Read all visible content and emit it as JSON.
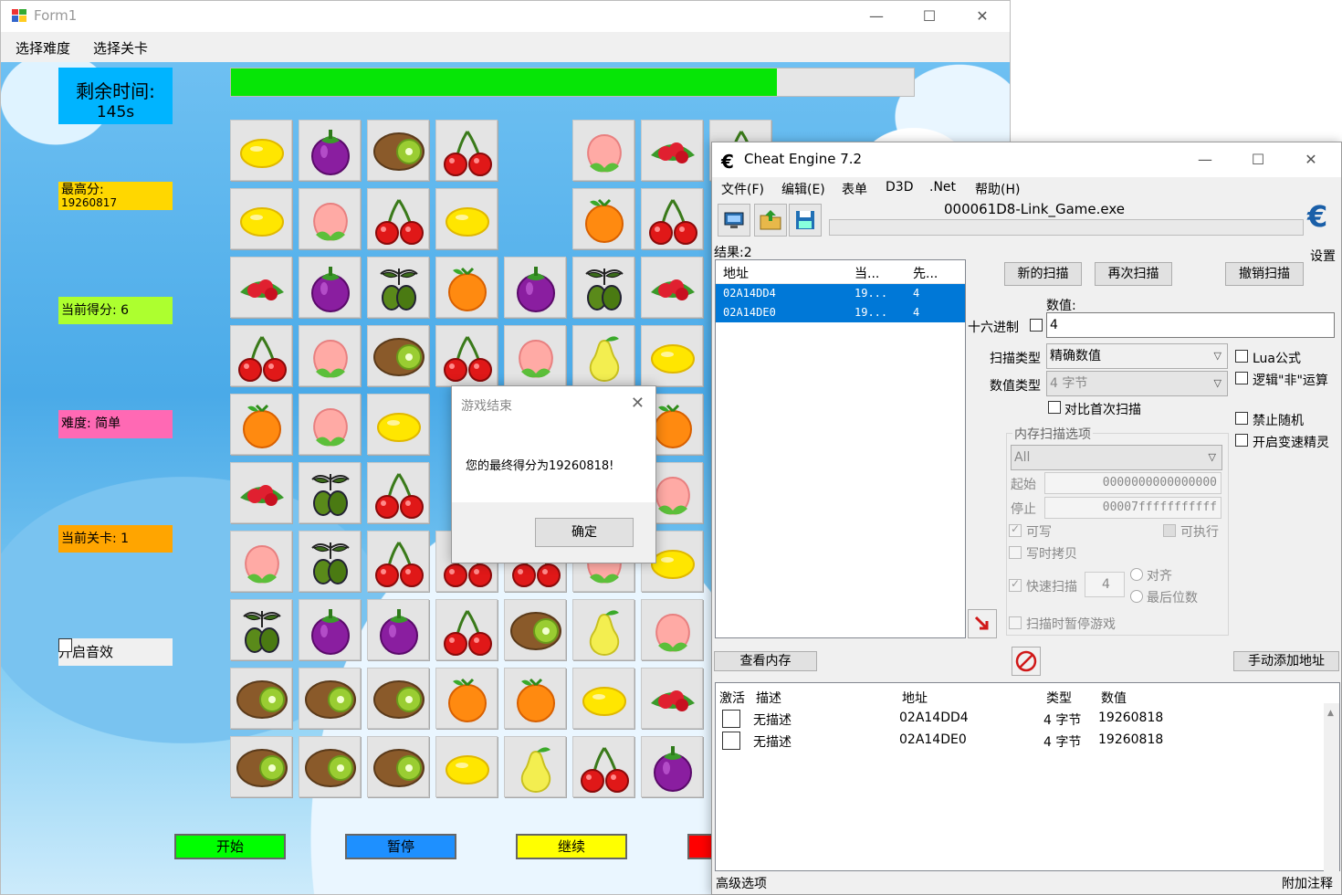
{
  "form1": {
    "title": "Form1",
    "menu": [
      "选择难度",
      "选择关卡"
    ],
    "timer_label": "剩余时间:",
    "timer_value": "145s",
    "best_label": "最高分:",
    "best_value": "19260817",
    "current_score": "当前得分: 6",
    "difficulty": "难度: 简单",
    "level": "当前关卡: 1",
    "sound_label": "开启音效",
    "progress": 0.8,
    "buttons": {
      "start": "开始",
      "pause": "暂停",
      "resume": "继续"
    },
    "button_colors": {
      "start": "#00ff00",
      "pause": "#1e90ff",
      "resume": "#ffff00",
      "stop": "#ff0000"
    },
    "grid": [
      [
        "lemon",
        "mangosteen",
        "kiwi",
        "cherry",
        "",
        "peach",
        "berries",
        "cherry"
      ],
      [
        "lemon",
        "peach",
        "cherry",
        "lemon",
        "",
        "orange",
        "cherry",
        ""
      ],
      [
        "berries",
        "mangosteen",
        "olive",
        "orange",
        "mangosteen",
        "olive",
        "berries",
        ""
      ],
      [
        "cherry",
        "peach",
        "kiwi",
        "cherry",
        "peach",
        "pear",
        "lemon",
        ""
      ],
      [
        "orange",
        "peach",
        "lemon",
        "",
        "",
        "",
        "orange",
        ""
      ],
      [
        "berries",
        "olive",
        "cherry",
        "",
        "",
        "",
        "peach",
        ""
      ],
      [
        "peach",
        "olive",
        "cherry",
        "cherry",
        "cherry",
        "peach",
        "lemon",
        ""
      ],
      [
        "olive",
        "mangosteen",
        "mangosteen",
        "cherry",
        "kiwi",
        "pear",
        "peach",
        ""
      ],
      [
        "kiwi",
        "kiwi",
        "kiwi",
        "orange",
        "orange",
        "lemon",
        "berries",
        ""
      ],
      [
        "kiwi",
        "kiwi",
        "kiwi",
        "lemon",
        "pear",
        "cherry",
        "mangosteen",
        ""
      ]
    ]
  },
  "dialog": {
    "title": "游戏结束",
    "message": "您的最终得分为19260818!",
    "ok": "确定"
  },
  "ce": {
    "title": "Cheat Engine 7.2",
    "menu": [
      "文件(F)",
      "编辑(E)",
      "表单",
      "D3D",
      ".Net",
      "帮助(H)"
    ],
    "process": "000061D8-Link_Game.exe",
    "settings": "设置",
    "results": "结果:2",
    "list_headers": [
      "地址",
      "当...",
      "先..."
    ],
    "results_rows": [
      {
        "addr": "02A14DD4",
        "cur": "19...",
        "prev": "4"
      },
      {
        "addr": "02A14DE0",
        "cur": "19...",
        "prev": "4"
      }
    ],
    "new_scan": "新的扫描",
    "next_scan": "再次扫描",
    "undo_scan": "撤销扫描",
    "value_label": "数值:",
    "hex_label": "十六进制",
    "value": "4",
    "scan_type_label": "扫描类型",
    "scan_type": "精确数值",
    "value_type_label": "数值类型",
    "value_type": "4 字节",
    "compare_first": "对比首次扫描",
    "lua": "Lua公式",
    "not_op": "逻辑\"非\"运算",
    "no_random": "禁止随机",
    "speedhack": "开启变速精灵",
    "mem_options": "内存扫描选项",
    "region": "All",
    "start_label": "起始",
    "start_value": "0000000000000000",
    "stop_label": "停止",
    "stop_value": "00007fffffffffff",
    "writable": "可写",
    "executable": "可执行",
    "cow": "写时拷贝",
    "fast_scan": "快速扫描",
    "fast_value": "4",
    "align": "对齐",
    "last_digits": "最后位数",
    "pause_game": "扫描时暂停游戏",
    "view_memory": "查看内存",
    "add_address": "手动添加地址",
    "table_headers": [
      "激活",
      "描述",
      "地址",
      "类型",
      "数值"
    ],
    "table_rows": [
      {
        "desc": "无描述",
        "addr": "02A14DD4",
        "type": "4 字节",
        "value": "19260818"
      },
      {
        "desc": "无描述",
        "addr": "02A14DE0",
        "type": "4 字节",
        "value": "19260818"
      }
    ],
    "advanced": "高级选项",
    "comments": "附加注释"
  }
}
